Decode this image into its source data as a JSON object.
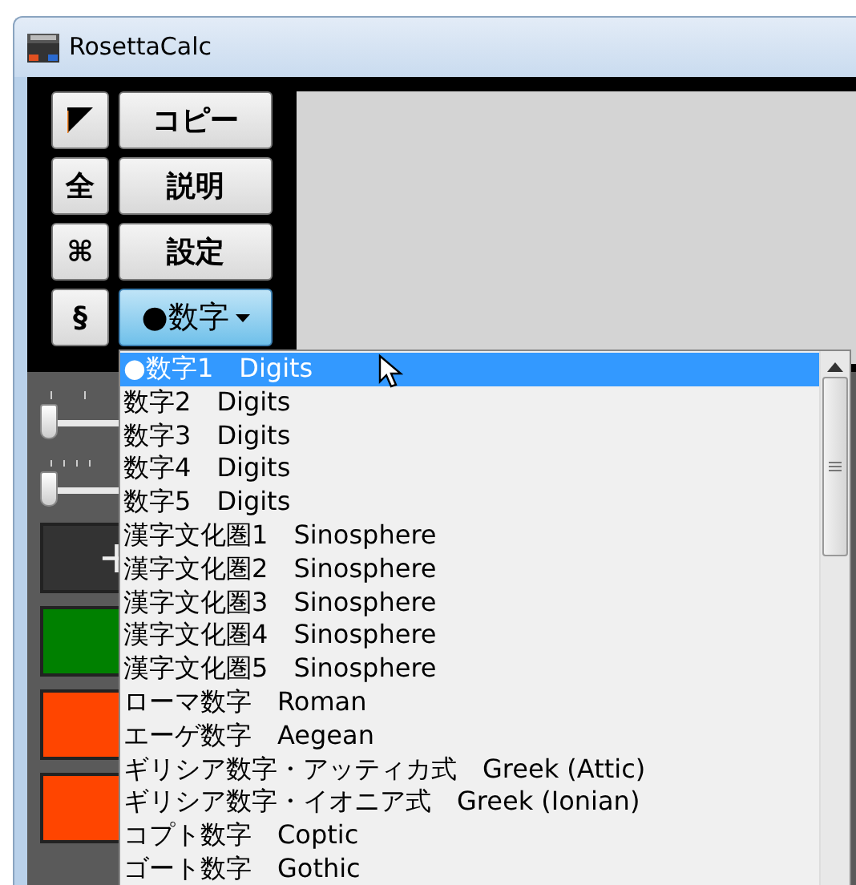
{
  "window": {
    "title": "RosettaCalc"
  },
  "side_buttons": [
    {
      "kind": "corner"
    },
    {
      "kind": "text",
      "label": "全"
    },
    {
      "kind": "text",
      "label": "⌘"
    },
    {
      "kind": "text",
      "label": "§"
    }
  ],
  "main_buttons": [
    {
      "label": "コピー"
    },
    {
      "label": "説明"
    },
    {
      "label": "設定"
    }
  ],
  "mode_dropdown": {
    "label": "●数字",
    "expanded": true
  },
  "sliders": [
    {
      "level": 0
    },
    {
      "level": 0
    }
  ],
  "keys": [
    {
      "label": "+",
      "color": "#333333"
    },
    {
      "color": "#008000"
    },
    {
      "color": "#ff4500"
    },
    {
      "color": "#ff4500"
    }
  ],
  "dropdown_list": {
    "items": [
      {
        "label": "●数字1",
        "sublabel": "Digits",
        "selected": true
      },
      {
        "label": "数字2",
        "sublabel": "Digits",
        "selected": false
      },
      {
        "label": "数字3",
        "sublabel": "Digits",
        "selected": false
      },
      {
        "label": "数字4",
        "sublabel": "Digits",
        "selected": false
      },
      {
        "label": "数字5",
        "sublabel": "Digits",
        "selected": false
      },
      {
        "label": "漢字文化圏1",
        "sublabel": "Sinosphere",
        "selected": false
      },
      {
        "label": "漢字文化圏2",
        "sublabel": "Sinosphere",
        "selected": false
      },
      {
        "label": "漢字文化圏3",
        "sublabel": "Sinosphere",
        "selected": false
      },
      {
        "label": "漢字文化圏4",
        "sublabel": "Sinosphere",
        "selected": false
      },
      {
        "label": "漢字文化圏5",
        "sublabel": "Sinosphere",
        "selected": false
      },
      {
        "label": "ローマ数字",
        "sublabel": "Roman",
        "selected": false
      },
      {
        "label": "エーゲ数字",
        "sublabel": "Aegean",
        "selected": false
      },
      {
        "label": "ギリシア数字・アッティカ式",
        "sublabel": "Greek (Attic)",
        "selected": false
      },
      {
        "label": "ギリシア数字・イオニア式",
        "sublabel": "Greek (Ionian)",
        "selected": false
      },
      {
        "label": "コプト数字",
        "sublabel": "Coptic",
        "selected": false
      },
      {
        "label": "ゴート数字",
        "sublabel": "Gothic",
        "selected": false
      }
    ]
  }
}
